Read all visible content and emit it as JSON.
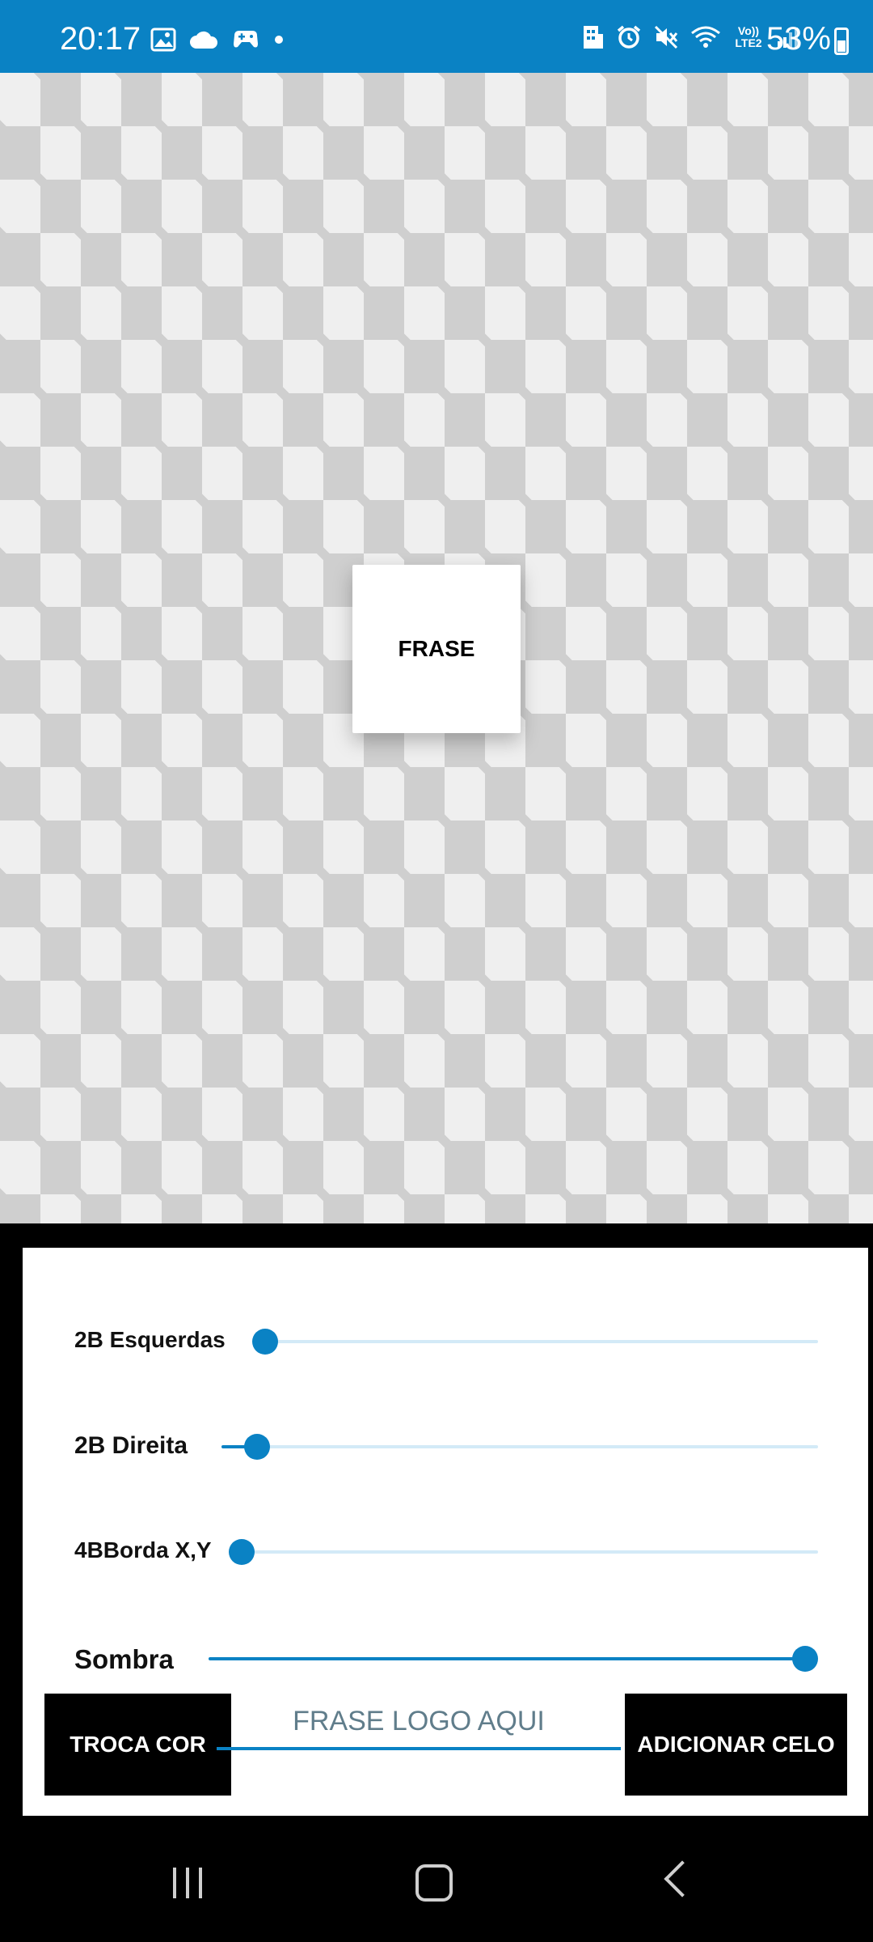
{
  "status_bar": {
    "time": "20:17",
    "battery": "53%",
    "icons_left": [
      "image-icon",
      "cloud-icon",
      "game-controller-icon",
      "dot-icon"
    ],
    "icons_right": [
      "building-icon",
      "alarm-icon",
      "mute-icon",
      "wifi-icon",
      "volte-icon",
      "signal-icon",
      "battery-icon"
    ],
    "volte_text": "Vo)) LTE2"
  },
  "canvas": {
    "sticker_text": "FRASE"
  },
  "sliders": [
    {
      "label": "2B Esquerdas",
      "value": 0.02
    },
    {
      "label": "2B Direita",
      "value": 0.06
    },
    {
      "label": "4BBorda X,Y",
      "value": 0.0
    },
    {
      "label": "Sombra",
      "value": 1.0
    }
  ],
  "buttons": {
    "swap_color": "TROCA COR",
    "add_seal": "ADICIONAR CELO"
  },
  "phrase_input": {
    "placeholder": "FRASE LOGO AQUI",
    "value": ""
  },
  "colors": {
    "accent": "#0a82c4",
    "track": "#d3eaf7"
  }
}
